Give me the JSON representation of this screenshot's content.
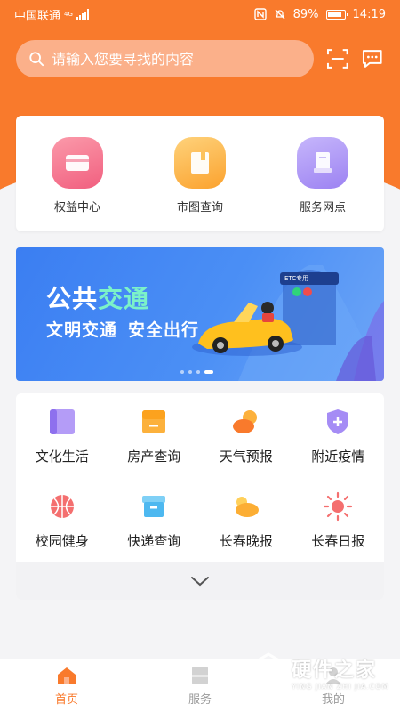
{
  "status_bar": {
    "carrier": "中国联通",
    "network": "4G",
    "battery": "89%",
    "time": "14:19"
  },
  "search": {
    "placeholder": "请输入您要寻找的内容"
  },
  "quick_actions": [
    {
      "label": "权益中心",
      "icon": "card-icon",
      "color": "#f46f8e"
    },
    {
      "label": "市图查询",
      "icon": "book-icon",
      "color": "#fcae34"
    },
    {
      "label": "服务网点",
      "icon": "document-icon",
      "color": "#a58cf5"
    }
  ],
  "banner": {
    "title_part1": "公共",
    "title_part2": "交通",
    "subtitle_part1": "文明交通",
    "subtitle_part2": "安全出行",
    "tag": "ETC专用",
    "slide_count": 4,
    "active_slide": 4
  },
  "services": [
    {
      "label": "文化生活",
      "icon": "book-icon",
      "color": "#a58cf5"
    },
    {
      "label": "房产查询",
      "icon": "house-icon",
      "color": "#fcae34"
    },
    {
      "label": "天气预报",
      "icon": "weather-icon",
      "color": "#f97a2c"
    },
    {
      "label": "附近疫情",
      "icon": "shield-plus-icon",
      "color": "#a58cf5"
    },
    {
      "label": "校园健身",
      "icon": "basketball-icon",
      "color": "#f46f6f"
    },
    {
      "label": "快递查询",
      "icon": "box-icon",
      "color": "#4db8f0"
    },
    {
      "label": "长春晚报",
      "icon": "cloud-sun-icon",
      "color": "#fcae34"
    },
    {
      "label": "长春日报",
      "icon": "sun-icon",
      "color": "#f46f6f"
    }
  ],
  "tabs": [
    {
      "label": "首页",
      "active": true
    },
    {
      "label": "服务",
      "active": false
    },
    {
      "label": "我的",
      "active": false
    }
  ],
  "watermark": {
    "cn": "硬件之家",
    "en": "YING JIAN ZHI JIA.COM"
  },
  "colors": {
    "primary": "#f97a2c",
    "banner_blue": "#3b7ef2",
    "background": "#f4f4f6"
  }
}
